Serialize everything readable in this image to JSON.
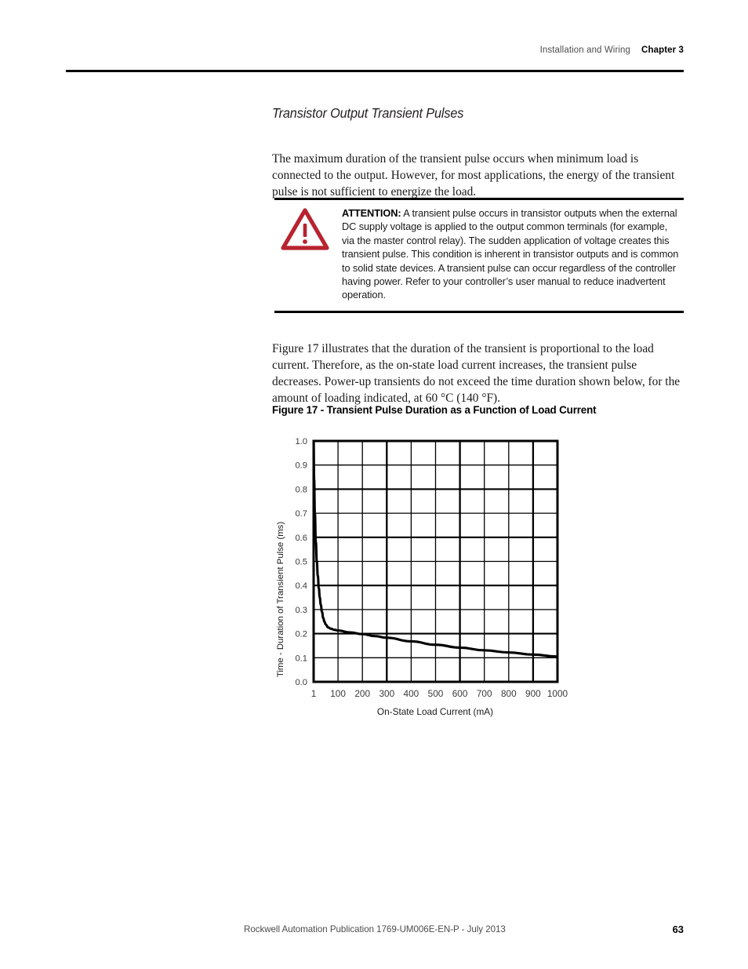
{
  "header": {
    "section": "Installation and Wiring",
    "chapter": "Chapter 3"
  },
  "section_heading": "Transistor Output Transient Pulses",
  "paragraphs": {
    "intro": "The maximum duration of the transient pulse occurs when minimum load is connected to the output. However, for most applications, the energy of the transient pulse is not sufficient to energize the load.",
    "figure_intro": "Figure 17 illustrates that the duration of the transient is proportional to the load current. Therefore, as the on-state load current increases, the transient pulse decreases. Power-up transients do not exceed the time duration shown below, for the amount of loading indicated, at 60 °C (140 °F)."
  },
  "attention": {
    "label": "ATTENTION:",
    "body": " A transient pulse occurs in transistor outputs when the external DC supply voltage is applied to the output common terminals (for example, via the master control relay). The sudden application of voltage creates this transient pulse. This condition is inherent in transistor outputs and is common to solid state devices. A transient pulse can occur regardless of the controller having power. Refer to your controller’s user manual to reduce inadvertent operation.",
    "icon_color": "#B8232F"
  },
  "figure_caption": "Figure 17 - Transient Pulse Duration as a Function of Load Current",
  "chart_data": {
    "type": "line",
    "title": "Transient Pulse Duration as a Function of Load Current",
    "xlabel": "On-State Load Current (mA)",
    "ylabel": "Time - Duration of Transient Pulse (ms)",
    "xlim": [
      1,
      1000
    ],
    "ylim": [
      0.0,
      1.0
    ],
    "grid": true,
    "legend": "none",
    "line_color": "#000000",
    "x_ticks": [
      "1",
      "100",
      "200",
      "300",
      "400",
      "500",
      "600",
      "700",
      "800",
      "900",
      "1000"
    ],
    "x_tick_values": [
      1,
      100,
      200,
      300,
      400,
      500,
      600,
      700,
      800,
      900,
      1000
    ],
    "y_ticks": [
      "0.0",
      "0.1",
      "0.2",
      "0.3",
      "0.4",
      "0.5",
      "0.6",
      "0.7",
      "0.8",
      "0.9",
      "1.0"
    ],
    "y_tick_values": [
      0.0,
      0.1,
      0.2,
      0.3,
      0.4,
      0.5,
      0.6,
      0.7,
      0.8,
      0.9,
      1.0
    ],
    "series": [
      {
        "name": "Transient pulse duration",
        "x": [
          1,
          3,
          6,
          10,
          14,
          18,
          22,
          26,
          30,
          35,
          40,
          45,
          50,
          60,
          70,
          85,
          100,
          150,
          200,
          250,
          300,
          400,
          500,
          600,
          700,
          800,
          900,
          1000
        ],
        "values": [
          1.0,
          0.84,
          0.7,
          0.58,
          0.5,
          0.44,
          0.39,
          0.35,
          0.32,
          0.29,
          0.265,
          0.25,
          0.238,
          0.226,
          0.221,
          0.216,
          0.213,
          0.205,
          0.198,
          0.19,
          0.183,
          0.168,
          0.154,
          0.142,
          0.131,
          0.122,
          0.113,
          0.105
        ]
      }
    ]
  },
  "footer": {
    "publication": "Rockwell Automation Publication 1769-UM006E-EN-P - July 2013",
    "page_number": "63"
  }
}
